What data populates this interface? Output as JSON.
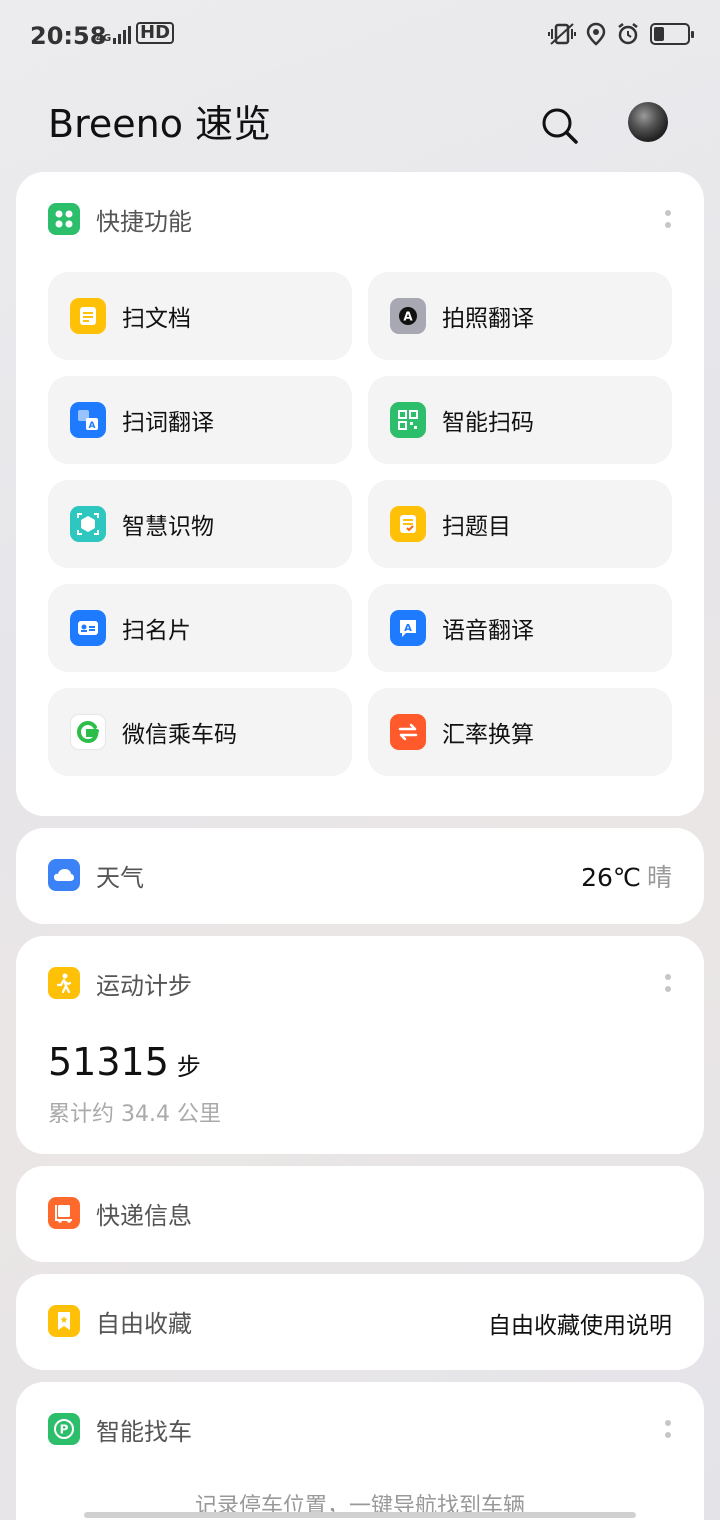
{
  "status_bar": {
    "time": "20:58",
    "network": "4G",
    "hd": "HD",
    "battery_level": 0.3
  },
  "header": {
    "title": "Breeno 速览"
  },
  "quick_functions": {
    "title": "快捷功能",
    "items": [
      {
        "label": "扫文档",
        "icon": "document-scan-icon",
        "color": "#FFC107"
      },
      {
        "label": "拍照翻译",
        "icon": "photo-translate-icon",
        "color": "#9E9EA8"
      },
      {
        "label": "扫词翻译",
        "icon": "word-translate-icon",
        "color": "#1E7BFF"
      },
      {
        "label": "智能扫码",
        "icon": "qr-code-icon",
        "color": "#2DBE6C"
      },
      {
        "label": "智慧识物",
        "icon": "object-recognition-icon",
        "color": "#2EC7C0"
      },
      {
        "label": "扫题目",
        "icon": "question-scan-icon",
        "color": "#FFC107"
      },
      {
        "label": "扫名片",
        "icon": "business-card-icon",
        "color": "#1E7BFF"
      },
      {
        "label": "语音翻译",
        "icon": "voice-translate-icon",
        "color": "#1E7BFF"
      },
      {
        "label": "微信乘车码",
        "icon": "wechat-transit-icon",
        "color": "#2DBE4A"
      },
      {
        "label": "汇率换算",
        "icon": "exchange-rate-icon",
        "color": "#FF5A2C"
      }
    ]
  },
  "weather": {
    "title": "天气",
    "temperature": "26℃",
    "condition": "晴"
  },
  "steps": {
    "title": "运动计步",
    "count": "51315",
    "unit": "步",
    "distance": "累计约 34.4 公里"
  },
  "express": {
    "title": "快递信息"
  },
  "favorites": {
    "title": "自由收藏",
    "link": "自由收藏使用说明"
  },
  "find_car": {
    "title": "智能找车",
    "hint": "记录停车位置，一键导航找到车辆"
  }
}
